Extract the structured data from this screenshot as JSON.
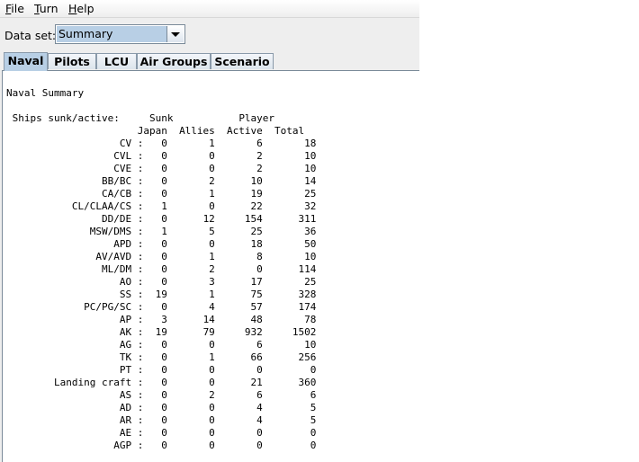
{
  "menu": [
    {
      "label": "File",
      "mnemonic": "F",
      "rest": "ile"
    },
    {
      "label": "Turn",
      "mnemonic": "T",
      "rest": "urn"
    },
    {
      "label": "Help",
      "mnemonic": "H",
      "rest": "elp"
    }
  ],
  "dataset": {
    "label": "Data set:",
    "value": "Summary"
  },
  "tabs": [
    "Naval",
    "Pilots",
    "LCU",
    "Air Groups",
    "Scenario"
  ],
  "active_tab": "Naval",
  "report": {
    "title": "Naval Summary",
    "section_label": "Ships sunk/active:",
    "group_headers": [
      "Sunk",
      "Player"
    ],
    "columns": [
      "Japan",
      "Allies",
      "Active",
      "Total"
    ],
    "rows": [
      {
        "type": "CV",
        "japan": "0",
        "allies": "1",
        "active": "6",
        "total": "18"
      },
      {
        "type": "CVL",
        "japan": "0",
        "allies": "0",
        "active": "2",
        "total": "10"
      },
      {
        "type": "CVE",
        "japan": "0",
        "allies": "0",
        "active": "2",
        "total": "10"
      },
      {
        "type": "BB/BC",
        "japan": "0",
        "allies": "2",
        "active": "10",
        "total": "14"
      },
      {
        "type": "CA/CB",
        "japan": "0",
        "allies": "1",
        "active": "19",
        "total": "25"
      },
      {
        "type": "CL/CLAA/CS",
        "japan": "1",
        "allies": "0",
        "active": "22",
        "total": "32"
      },
      {
        "type": "DD/DE",
        "japan": "0",
        "allies": "12",
        "active": "154",
        "total": "311"
      },
      {
        "type": "MSW/DMS",
        "japan": "1",
        "allies": "5",
        "active": "25",
        "total": "36"
      },
      {
        "type": "APD",
        "japan": "0",
        "allies": "0",
        "active": "18",
        "total": "50"
      },
      {
        "type": "AV/AVD",
        "japan": "0",
        "allies": "1",
        "active": "8",
        "total": "10"
      },
      {
        "type": "ML/DM",
        "japan": "0",
        "allies": "2",
        "active": "0",
        "total": "114"
      },
      {
        "type": "AO",
        "japan": "0",
        "allies": "3",
        "active": "17",
        "total": "25"
      },
      {
        "type": "SS",
        "japan": "19",
        "allies": "1",
        "active": "75",
        "total": "328"
      },
      {
        "type": "PC/PG/SC",
        "japan": "0",
        "allies": "4",
        "active": "57",
        "total": "174"
      },
      {
        "type": "AP",
        "japan": "3",
        "allies": "14",
        "active": "48",
        "total": "78"
      },
      {
        "type": "AK",
        "japan": "19",
        "allies": "79",
        "active": "932",
        "total": "1502"
      },
      {
        "type": "AG",
        "japan": "0",
        "allies": "0",
        "active": "6",
        "total": "10"
      },
      {
        "type": "TK",
        "japan": "0",
        "allies": "1",
        "active": "66",
        "total": "256"
      },
      {
        "type": "PT",
        "japan": "0",
        "allies": "0",
        "active": "0",
        "total": "0"
      },
      {
        "type": "Landing craft",
        "japan": "0",
        "allies": "0",
        "active": "21",
        "total": "360"
      },
      {
        "type": "AS",
        "japan": "0",
        "allies": "2",
        "active": "6",
        "total": "6"
      },
      {
        "type": "AD",
        "japan": "0",
        "allies": "0",
        "active": "4",
        "total": "5"
      },
      {
        "type": "AR",
        "japan": "0",
        "allies": "0",
        "active": "4",
        "total": "5"
      },
      {
        "type": "AE",
        "japan": "0",
        "allies": "0",
        "active": "0",
        "total": "0"
      },
      {
        "type": "AGP",
        "japan": "0",
        "allies": "0",
        "active": "0",
        "total": "0"
      }
    ]
  }
}
